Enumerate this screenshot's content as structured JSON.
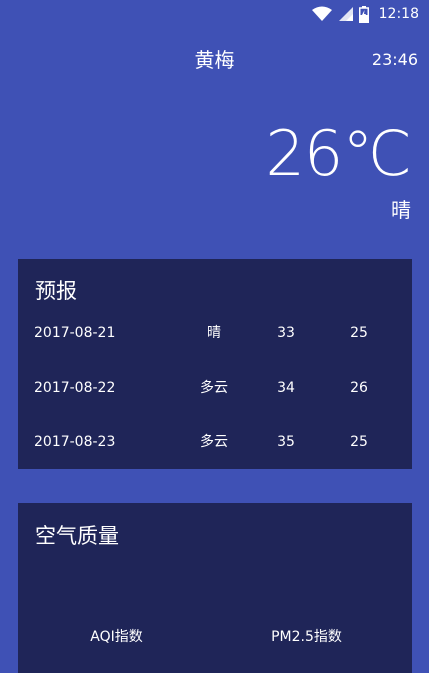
{
  "status_bar": {
    "time": "12:18"
  },
  "header": {
    "city": "黄梅",
    "update_time": "23:46"
  },
  "now": {
    "temperature": "26℃",
    "weather": "晴"
  },
  "forecast": {
    "title": "预报",
    "rows": [
      {
        "date": "2017-08-21",
        "condition": "晴",
        "max": "33",
        "min": "25"
      },
      {
        "date": "2017-08-22",
        "condition": "多云",
        "max": "34",
        "min": "26"
      },
      {
        "date": "2017-08-23",
        "condition": "多云",
        "max": "35",
        "min": "25"
      }
    ]
  },
  "aqi": {
    "title": "空气质量",
    "aqi_label": "AQI指数",
    "pm25_label": "PM2.5指数"
  },
  "colors": {
    "background": "#3f51b5",
    "card": "#1f2558",
    "text": "#ffffff"
  },
  "icons": [
    "wifi-icon",
    "signal-icon",
    "battery-icon"
  ]
}
